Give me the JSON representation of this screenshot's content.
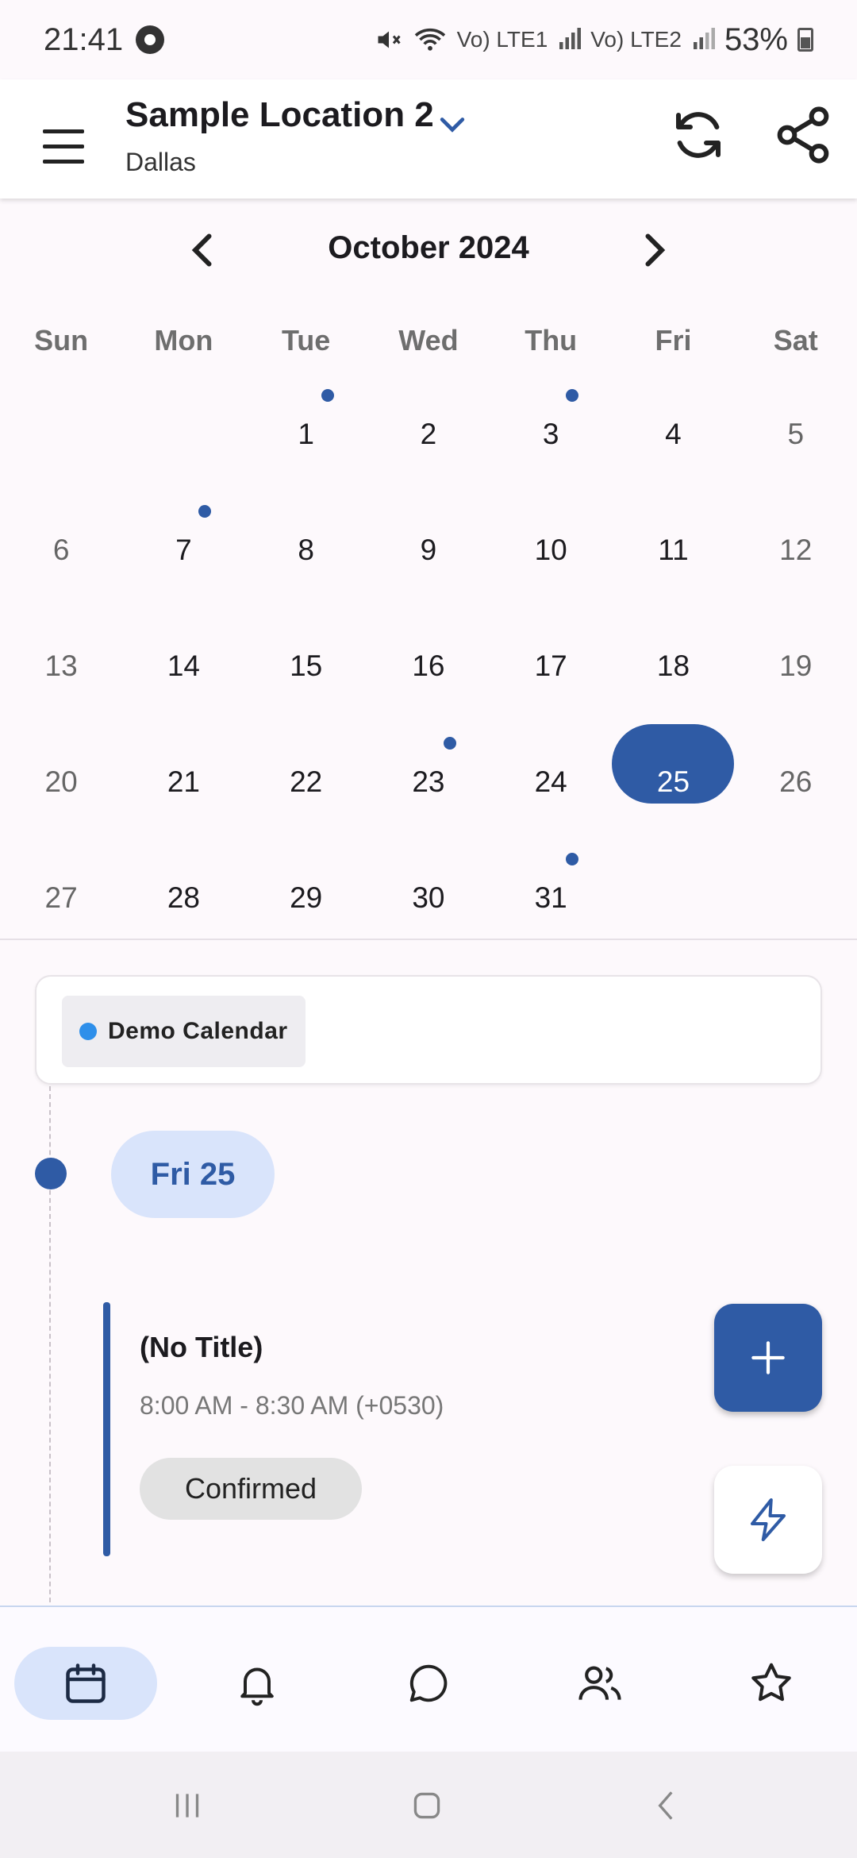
{
  "status_bar": {
    "time": "21:41",
    "battery": "53%",
    "sim1": "Vo) LTE1",
    "sim2": "Vo) LTE2"
  },
  "app_bar": {
    "location_name": "Sample Location 2",
    "location_city": "Dallas"
  },
  "calendar": {
    "month_label": "October 2024",
    "weekdays": [
      "Sun",
      "Mon",
      "Tue",
      "Wed",
      "Thu",
      "Fri",
      "Sat"
    ],
    "selected_day": 25,
    "days_with_events": [
      1,
      3,
      7,
      23,
      31
    ]
  },
  "filter": {
    "chip_label": "Demo Calendar",
    "chip_color": "#2e8fea"
  },
  "agenda": {
    "date_label": "Fri 25",
    "event": {
      "title": "(No Title)",
      "time": "8:00 AM - 8:30 AM (+0530)",
      "status": "Confirmed"
    }
  },
  "bottom_nav": {
    "items": [
      {
        "icon": "calendar-icon",
        "active": true
      },
      {
        "icon": "bell-icon",
        "active": false
      },
      {
        "icon": "chat-icon",
        "active": false
      },
      {
        "icon": "contacts-icon",
        "active": false
      },
      {
        "icon": "star-icon",
        "active": false
      }
    ]
  },
  "colors": {
    "primary": "#2f5ba5",
    "primary_container": "#d9e4fb"
  }
}
